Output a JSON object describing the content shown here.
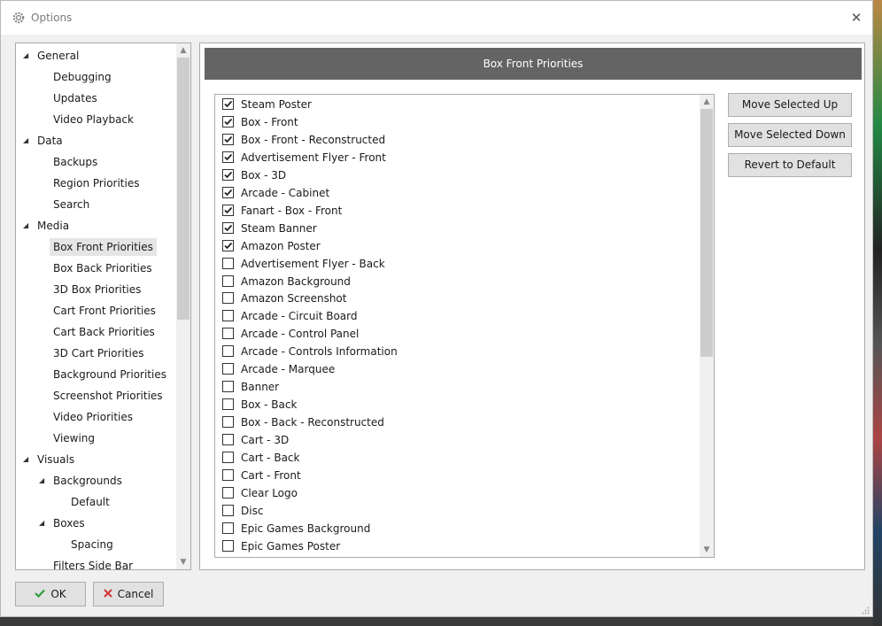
{
  "window": {
    "title": "Options",
    "close_glyph": "✕"
  },
  "tree": {
    "items": [
      {
        "label": "General",
        "level": 0,
        "expandable": true
      },
      {
        "label": "Debugging",
        "level": 1,
        "expandable": false
      },
      {
        "label": "Updates",
        "level": 1,
        "expandable": false
      },
      {
        "label": "Video Playback",
        "level": 1,
        "expandable": false
      },
      {
        "label": "Data",
        "level": 0,
        "expandable": true
      },
      {
        "label": "Backups",
        "level": 1,
        "expandable": false
      },
      {
        "label": "Region Priorities",
        "level": 1,
        "expandable": false
      },
      {
        "label": "Search",
        "level": 1,
        "expandable": false
      },
      {
        "label": "Media",
        "level": 0,
        "expandable": true
      },
      {
        "label": "Box Front Priorities",
        "level": 1,
        "expandable": false,
        "selected": true
      },
      {
        "label": "Box Back Priorities",
        "level": 1,
        "expandable": false
      },
      {
        "label": "3D Box Priorities",
        "level": 1,
        "expandable": false
      },
      {
        "label": "Cart Front Priorities",
        "level": 1,
        "expandable": false
      },
      {
        "label": "Cart Back Priorities",
        "level": 1,
        "expandable": false
      },
      {
        "label": "3D Cart Priorities",
        "level": 1,
        "expandable": false
      },
      {
        "label": "Background Priorities",
        "level": 1,
        "expandable": false
      },
      {
        "label": "Screenshot Priorities",
        "level": 1,
        "expandable": false
      },
      {
        "label": "Video Priorities",
        "level": 1,
        "expandable": false
      },
      {
        "label": "Viewing",
        "level": 1,
        "expandable": false
      },
      {
        "label": "Visuals",
        "level": 0,
        "expandable": true
      },
      {
        "label": "Backgrounds",
        "level": 1,
        "expandable": true
      },
      {
        "label": "Default",
        "level": 2,
        "expandable": false
      },
      {
        "label": "Boxes",
        "level": 1,
        "expandable": true
      },
      {
        "label": "Spacing",
        "level": 2,
        "expandable": false
      },
      {
        "label": "Filters Side Bar",
        "level": 1,
        "expandable": false
      }
    ]
  },
  "panel": {
    "header": "Box Front Priorities",
    "items": [
      {
        "label": "Steam Poster",
        "checked": true
      },
      {
        "label": "Box - Front",
        "checked": true
      },
      {
        "label": "Box - Front - Reconstructed",
        "checked": true
      },
      {
        "label": "Advertisement Flyer - Front",
        "checked": true
      },
      {
        "label": "Box - 3D",
        "checked": true
      },
      {
        "label": "Arcade - Cabinet",
        "checked": true
      },
      {
        "label": "Fanart - Box - Front",
        "checked": true
      },
      {
        "label": "Steam Banner",
        "checked": true
      },
      {
        "label": "Amazon Poster",
        "checked": true
      },
      {
        "label": "Advertisement Flyer - Back",
        "checked": false
      },
      {
        "label": "Amazon Background",
        "checked": false
      },
      {
        "label": "Amazon Screenshot",
        "checked": false
      },
      {
        "label": "Arcade - Circuit Board",
        "checked": false
      },
      {
        "label": "Arcade - Control Panel",
        "checked": false
      },
      {
        "label": "Arcade - Controls Information",
        "checked": false
      },
      {
        "label": "Arcade - Marquee",
        "checked": false
      },
      {
        "label": "Banner",
        "checked": false
      },
      {
        "label": "Box - Back",
        "checked": false
      },
      {
        "label": "Box - Back - Reconstructed",
        "checked": false
      },
      {
        "label": "Cart - 3D",
        "checked": false
      },
      {
        "label": "Cart - Back",
        "checked": false
      },
      {
        "label": "Cart - Front",
        "checked": false
      },
      {
        "label": "Clear Logo",
        "checked": false
      },
      {
        "label": "Disc",
        "checked": false
      },
      {
        "label": "Epic Games Background",
        "checked": false
      },
      {
        "label": "Epic Games Poster",
        "checked": false
      }
    ],
    "buttons": {
      "move_up": "Move Selected Up",
      "move_down": "Move Selected Down",
      "revert": "Revert to Default"
    }
  },
  "footer": {
    "ok": "OK",
    "cancel": "Cancel"
  },
  "colors": {
    "header_bg": "#646464",
    "ok_icon": "#2e9d3e",
    "cancel_icon": "#d23a3a",
    "selection": "#e5e5e5"
  }
}
